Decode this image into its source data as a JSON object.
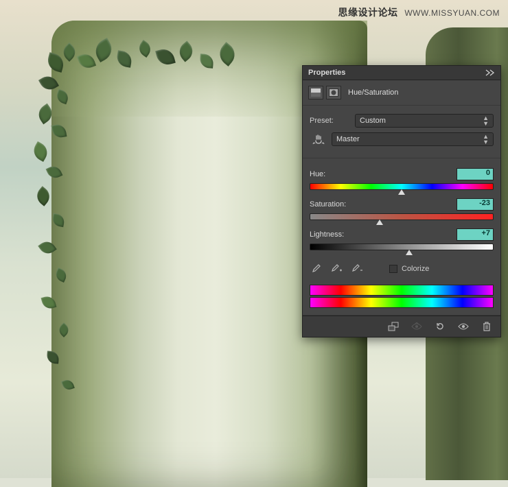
{
  "watermark": {
    "cn": "思缘设计论坛",
    "en": "WWW.MISSYUAN.COM"
  },
  "panel": {
    "title": "Properties",
    "adjustment": "Hue/Saturation",
    "preset_label": "Preset:",
    "preset_value": "Custom",
    "channel_value": "Master",
    "hue": {
      "label": "Hue:",
      "value": "0",
      "pos": 50
    },
    "saturation": {
      "label": "Saturation:",
      "value": "-23",
      "pos": 38
    },
    "lightness": {
      "label": "Lightness:",
      "value": "+7",
      "pos": 54
    },
    "colorize_label": "Colorize",
    "icons": {
      "collapse": "collapse-icon",
      "adj_hsl": "hsl-adjustment-icon",
      "adj_mask": "layer-mask-icon",
      "hand": "hand-scrubby-icon",
      "eyedropper": "eyedropper-icon",
      "eyedropper_plus": "eyedropper-plus-icon",
      "eyedropper_minus": "eyedropper-minus-icon",
      "clip": "clip-to-layer-icon",
      "view_prev": "view-previous-icon",
      "reset": "reset-icon",
      "visibility": "visibility-icon",
      "trash": "trash-icon"
    }
  }
}
